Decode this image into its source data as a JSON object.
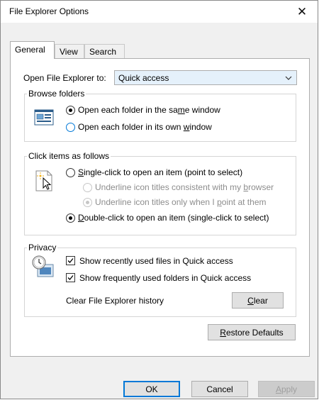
{
  "window": {
    "title": "File Explorer Options",
    "close_glyph": "✕"
  },
  "tabs": [
    {
      "label": "General",
      "active": true
    },
    {
      "label": "View",
      "active": false
    },
    {
      "label": "Search",
      "active": false
    }
  ],
  "open_to": {
    "label": "Open File Explorer to:",
    "value": "Quick access"
  },
  "browse": {
    "title": "Browse folders",
    "same_window": {
      "pre": "Open each folder in the sa",
      "key": "m",
      "post": "e window",
      "selected": true
    },
    "own_window": {
      "pre": "Open each folder in its own ",
      "key": "w",
      "post": "indow",
      "selected": false
    }
  },
  "click": {
    "title": "Click items as follows",
    "single": {
      "key": "S",
      "post": "ingle-click to open an item (point to select)",
      "selected": false
    },
    "underline_browser": {
      "pre": "Underline icon titles consistent with my ",
      "key": "b",
      "post": "rowser",
      "selected": false
    },
    "underline_point": {
      "pre": "Underline icon titles only when I ",
      "key": "p",
      "post": "oint at them",
      "selected": true
    },
    "double": {
      "key": "D",
      "post": "ouble-click to open an item (single-click to select)",
      "selected": true
    }
  },
  "privacy": {
    "title": "Privacy",
    "recent_files": {
      "label": "Show recently used files in Quick access",
      "checked": true
    },
    "frequent_folders": {
      "label": "Show frequently used folders in Quick access",
      "checked": true
    },
    "clear_history": {
      "label": "Clear File Explorer history",
      "button_key": "C",
      "button_post": "lear"
    }
  },
  "restore": {
    "key": "R",
    "post": "estore Defaults"
  },
  "footer": {
    "ok": "OK",
    "cancel": "Cancel",
    "apply_key": "A",
    "apply_post": "pply"
  }
}
